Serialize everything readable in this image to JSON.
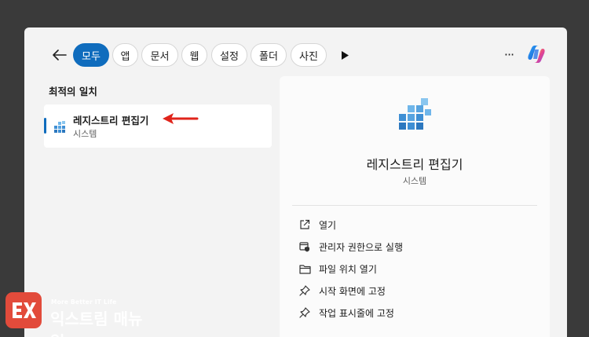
{
  "filters": {
    "tabs": [
      {
        "label": "모두",
        "active": true
      },
      {
        "label": "앱"
      },
      {
        "label": "문서"
      },
      {
        "label": "웹"
      },
      {
        "label": "설정"
      },
      {
        "label": "폴더"
      },
      {
        "label": "사진"
      }
    ],
    "back_icon": "arrow-left-icon",
    "more_icon": "ellipsis-icon",
    "play_icon": "play-icon",
    "copilot_icon": "copilot-icon"
  },
  "best_match": {
    "heading": "최적의 일치",
    "app_name": "레지스트리 편집기",
    "app_type": "시스템",
    "icon": "registry-editor-icon"
  },
  "detail": {
    "app_name": "레지스트리 편집기",
    "app_type": "시스템",
    "actions": [
      {
        "label": "열기",
        "icon": "open-external-icon"
      },
      {
        "label": "관리자 권한으로 실행",
        "icon": "admin-shield-icon"
      },
      {
        "label": "파일 위치 열기",
        "icon": "folder-icon"
      },
      {
        "label": "시작 화면에 고정",
        "icon": "pin-icon"
      },
      {
        "label": "작업 표시줄에 고정",
        "icon": "pin-icon"
      }
    ]
  },
  "watermark": {
    "tagline": "More Better IT Life",
    "name": "익스트림 매뉴얼"
  },
  "colors": {
    "accent": "#0f6cbd",
    "background": "#3a3a3a",
    "panel": "#f3f3f3",
    "annotation_arrow": "#e0241b",
    "logo": "#e24b3b"
  }
}
